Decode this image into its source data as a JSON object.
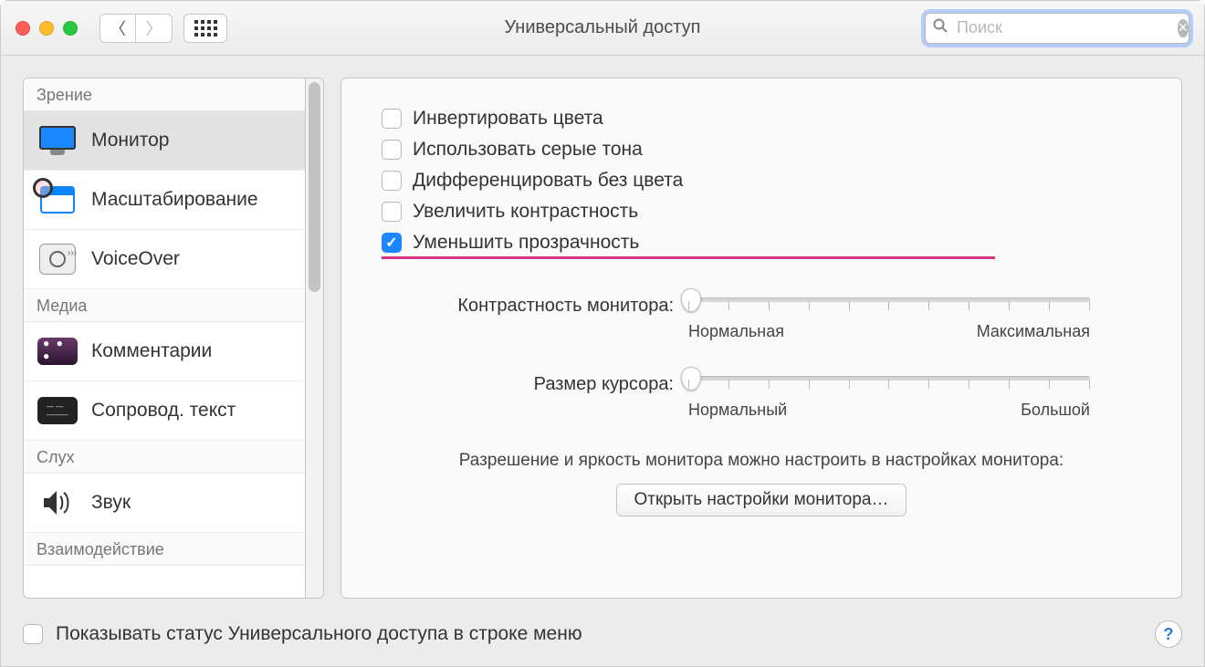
{
  "window": {
    "title": "Универсальный доступ"
  },
  "search": {
    "placeholder": "Поиск",
    "value": ""
  },
  "sidebar": {
    "sections": [
      {
        "title": "Зрение",
        "items": [
          {
            "label": "Монитор",
            "icon": "monitor-icon",
            "selected": true
          },
          {
            "label": "Масштабирование",
            "icon": "zoom-icon",
            "selected": false
          },
          {
            "label": "VoiceOver",
            "icon": "voiceover-icon",
            "selected": false
          }
        ]
      },
      {
        "title": "Медиа",
        "items": [
          {
            "label": "Комментарии",
            "icon": "comments-icon",
            "selected": false
          },
          {
            "label": "Сопровод. текст",
            "icon": "captions-icon",
            "selected": false
          }
        ]
      },
      {
        "title": "Слух",
        "items": [
          {
            "label": "Звук",
            "icon": "sound-icon",
            "selected": false
          }
        ]
      },
      {
        "title": "Взаимодействие",
        "items": []
      }
    ]
  },
  "main": {
    "checkboxes": [
      {
        "label": "Инвертировать цвета",
        "checked": false
      },
      {
        "label": "Использовать серые тона",
        "checked": false
      },
      {
        "label": "Дифференцировать без цвета",
        "checked": false
      },
      {
        "label": "Увеличить контрастность",
        "checked": false
      },
      {
        "label": "Уменьшить прозрачность",
        "checked": true
      }
    ],
    "contrast": {
      "label": "Контрастность монитора:",
      "min_label": "Нормальная",
      "max_label": "Максимальная",
      "value": 0
    },
    "cursor": {
      "label": "Размер курсора:",
      "min_label": "Нормальный",
      "max_label": "Большой",
      "value": 0
    },
    "hint": "Разрешение и яркость монитора можно настроить в настройках монитора:",
    "open_button": "Открыть настройки монитора…"
  },
  "footer": {
    "show_status_label": "Показывать статус Универсального доступа в строке меню",
    "show_status_checked": false
  }
}
